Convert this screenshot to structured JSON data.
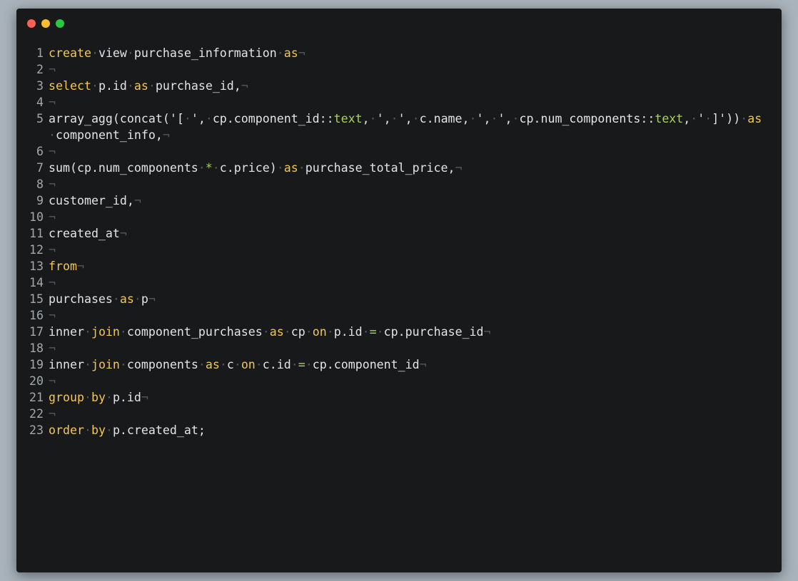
{
  "window": {
    "controls": [
      "close",
      "minimize",
      "zoom"
    ],
    "colors": {
      "background": "#17191b",
      "keyword": "#f5c652",
      "type": "#a9d351",
      "text": "#e4e4e2",
      "invisible": "#54595c",
      "line_number": "#a5a8aa"
    }
  },
  "editor": {
    "space_marker": "·",
    "eol_marker": "¬",
    "lines": [
      {
        "n": "1",
        "tokens": [
          [
            "kw",
            "create"
          ],
          [
            "p",
            " view "
          ],
          [
            "p",
            "purchase_information "
          ],
          [
            "kw",
            "as"
          ]
        ]
      },
      {
        "n": "2",
        "tokens": []
      },
      {
        "n": "3",
        "tokens": [
          [
            "kw",
            "select"
          ],
          [
            "p",
            " p.id "
          ],
          [
            "kw",
            "as"
          ],
          [
            "p",
            " purchase_id,"
          ]
        ]
      },
      {
        "n": "4",
        "tokens": []
      },
      {
        "n": "5",
        "tokens": [
          [
            "p",
            "array_agg(concat('[ ', cp.component_id::"
          ],
          [
            "ty",
            "text"
          ],
          [
            "p",
            ", ', ', c.name, ', ', cp.num_components::"
          ],
          [
            "ty",
            "text"
          ],
          [
            "p",
            ", ' ]')) "
          ],
          [
            "kw",
            "as"
          ],
          [
            "p",
            " component_info,"
          ]
        ]
      },
      {
        "n": "6",
        "tokens": []
      },
      {
        "n": "7",
        "tokens": [
          [
            "p",
            "sum(cp.num_components "
          ],
          [
            "ty",
            "*"
          ],
          [
            "p",
            " c.price) "
          ],
          [
            "kw",
            "as"
          ],
          [
            "p",
            " purchase_total_price,"
          ]
        ]
      },
      {
        "n": "8",
        "tokens": []
      },
      {
        "n": "9",
        "tokens": [
          [
            "p",
            "customer_id,"
          ]
        ]
      },
      {
        "n": "10",
        "tokens": []
      },
      {
        "n": "11",
        "tokens": [
          [
            "p",
            "created_at"
          ]
        ]
      },
      {
        "n": "12",
        "tokens": []
      },
      {
        "n": "13",
        "tokens": [
          [
            "kw",
            "from"
          ]
        ]
      },
      {
        "n": "14",
        "tokens": []
      },
      {
        "n": "15",
        "tokens": [
          [
            "p",
            "purchases "
          ],
          [
            "kw",
            "as"
          ],
          [
            "p",
            " p"
          ]
        ]
      },
      {
        "n": "16",
        "tokens": []
      },
      {
        "n": "17",
        "tokens": [
          [
            "p",
            "inner "
          ],
          [
            "kw",
            "join"
          ],
          [
            "p",
            " component_purchases "
          ],
          [
            "kw",
            "as"
          ],
          [
            "p",
            " cp "
          ],
          [
            "kw",
            "on"
          ],
          [
            "p",
            " p.id "
          ],
          [
            "ty",
            "="
          ],
          [
            "p",
            " cp.purchase_id"
          ]
        ]
      },
      {
        "n": "18",
        "tokens": []
      },
      {
        "n": "19",
        "tokens": [
          [
            "p",
            "inner "
          ],
          [
            "kw",
            "join"
          ],
          [
            "p",
            " components "
          ],
          [
            "kw",
            "as"
          ],
          [
            "p",
            " c "
          ],
          [
            "kw",
            "on"
          ],
          [
            "p",
            " c.id "
          ],
          [
            "ty",
            "="
          ],
          [
            "p",
            " cp.component_id"
          ]
        ]
      },
      {
        "n": "20",
        "tokens": []
      },
      {
        "n": "21",
        "tokens": [
          [
            "kw",
            "group"
          ],
          [
            "p",
            " "
          ],
          [
            "kw",
            "by"
          ],
          [
            "p",
            " p.id"
          ]
        ]
      },
      {
        "n": "22",
        "tokens": []
      },
      {
        "n": "23",
        "tokens": [
          [
            "kw",
            "order"
          ],
          [
            "p",
            " "
          ],
          [
            "kw",
            "by"
          ],
          [
            "p",
            " p.created_at;"
          ]
        ],
        "no_eol": true
      }
    ]
  }
}
